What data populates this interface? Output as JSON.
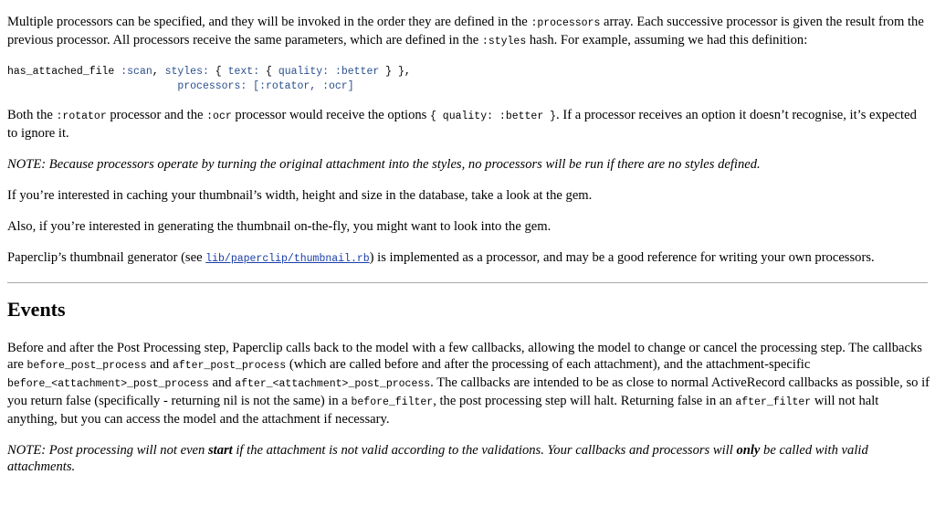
{
  "intro": {
    "t1": "Multiple processors can be specified, and they will be invoked in the order they are defined in the ",
    "c1": ":processors",
    "t2": " array. Each successive processor is given the result from the previous processor. All processors receive the same parameters, which are defined in the ",
    "c2": ":styles",
    "t3": " hash. For example, assuming we had this definition:"
  },
  "code": {
    "l1_method": "has_attached_file",
    "l1_scan": ":scan",
    "l1_styles": "styles:",
    "l1_open1": "{",
    "l1_text": "text:",
    "l1_open2": "{",
    "l1_quality": "quality:",
    "l1_better": ":better",
    "l1_close": "} },",
    "l2_processors": "processors:",
    "l2_list": "[:rotator, :ocr]"
  },
  "options_para": {
    "t1": "Both the ",
    "c1": ":rotator",
    "t2": " processor and the ",
    "c2": ":ocr",
    "t3": " processor would receive the options ",
    "c3": "{ quality: :better }",
    "t4": ". If a processor receives an option it doesn’t recognise, it’s expected to ignore it."
  },
  "note1": "NOTE: Because processors operate by turning the original attachment into the styles, no processors will be run if there are no styles defined.",
  "caching_para": "If you’re interested in caching your thumbnail’s width, height and size in the database, take a look at the gem.",
  "onthefly_para": "Also, if you’re interested in generating the thumbnail on-the-fly, you might want to look into the gem.",
  "thumb_para": {
    "t1": "Paperclip’s thumbnail generator (see ",
    "link": "lib/paperclip/thumbnail.rb",
    "t2": ") is implemented as a processor, and may be a good reference for writing your own processors."
  },
  "events": {
    "heading": "Events",
    "p_t1": "Before and after the Post Processing step, Paperclip calls back to the model with a few callbacks, allowing the model to change or cancel the processing step. The callbacks are ",
    "p_c1": "before_post_process",
    "p_t2": " and ",
    "p_c2": "after_post_process",
    "p_t3": " (which are called before and after the processing of each attachment), and the attachment-specific ",
    "p_c3": "before_<attachment>_post_process",
    "p_t4": " and ",
    "p_c4": "after_<attachment>_post_process",
    "p_t5": ". The callbacks are intended to be as close to normal ActiveRecord callbacks as possible, so if you return false (specifically - returning nil is not the same) in a ",
    "p_c5": "before_filter",
    "p_t6": ", the post processing step will halt. Returning false in an ",
    "p_c6": "after_filter",
    "p_t7": " will not halt anything, but you can access the model and the attachment if necessary.",
    "note_t1": "NOTE: Post processing will not even ",
    "note_b1": "start",
    "note_t2": " if the attachment is not valid according to the validations. Your callbacks and processors will ",
    "note_b2": "only",
    "note_t3": " be called with valid attachments."
  }
}
